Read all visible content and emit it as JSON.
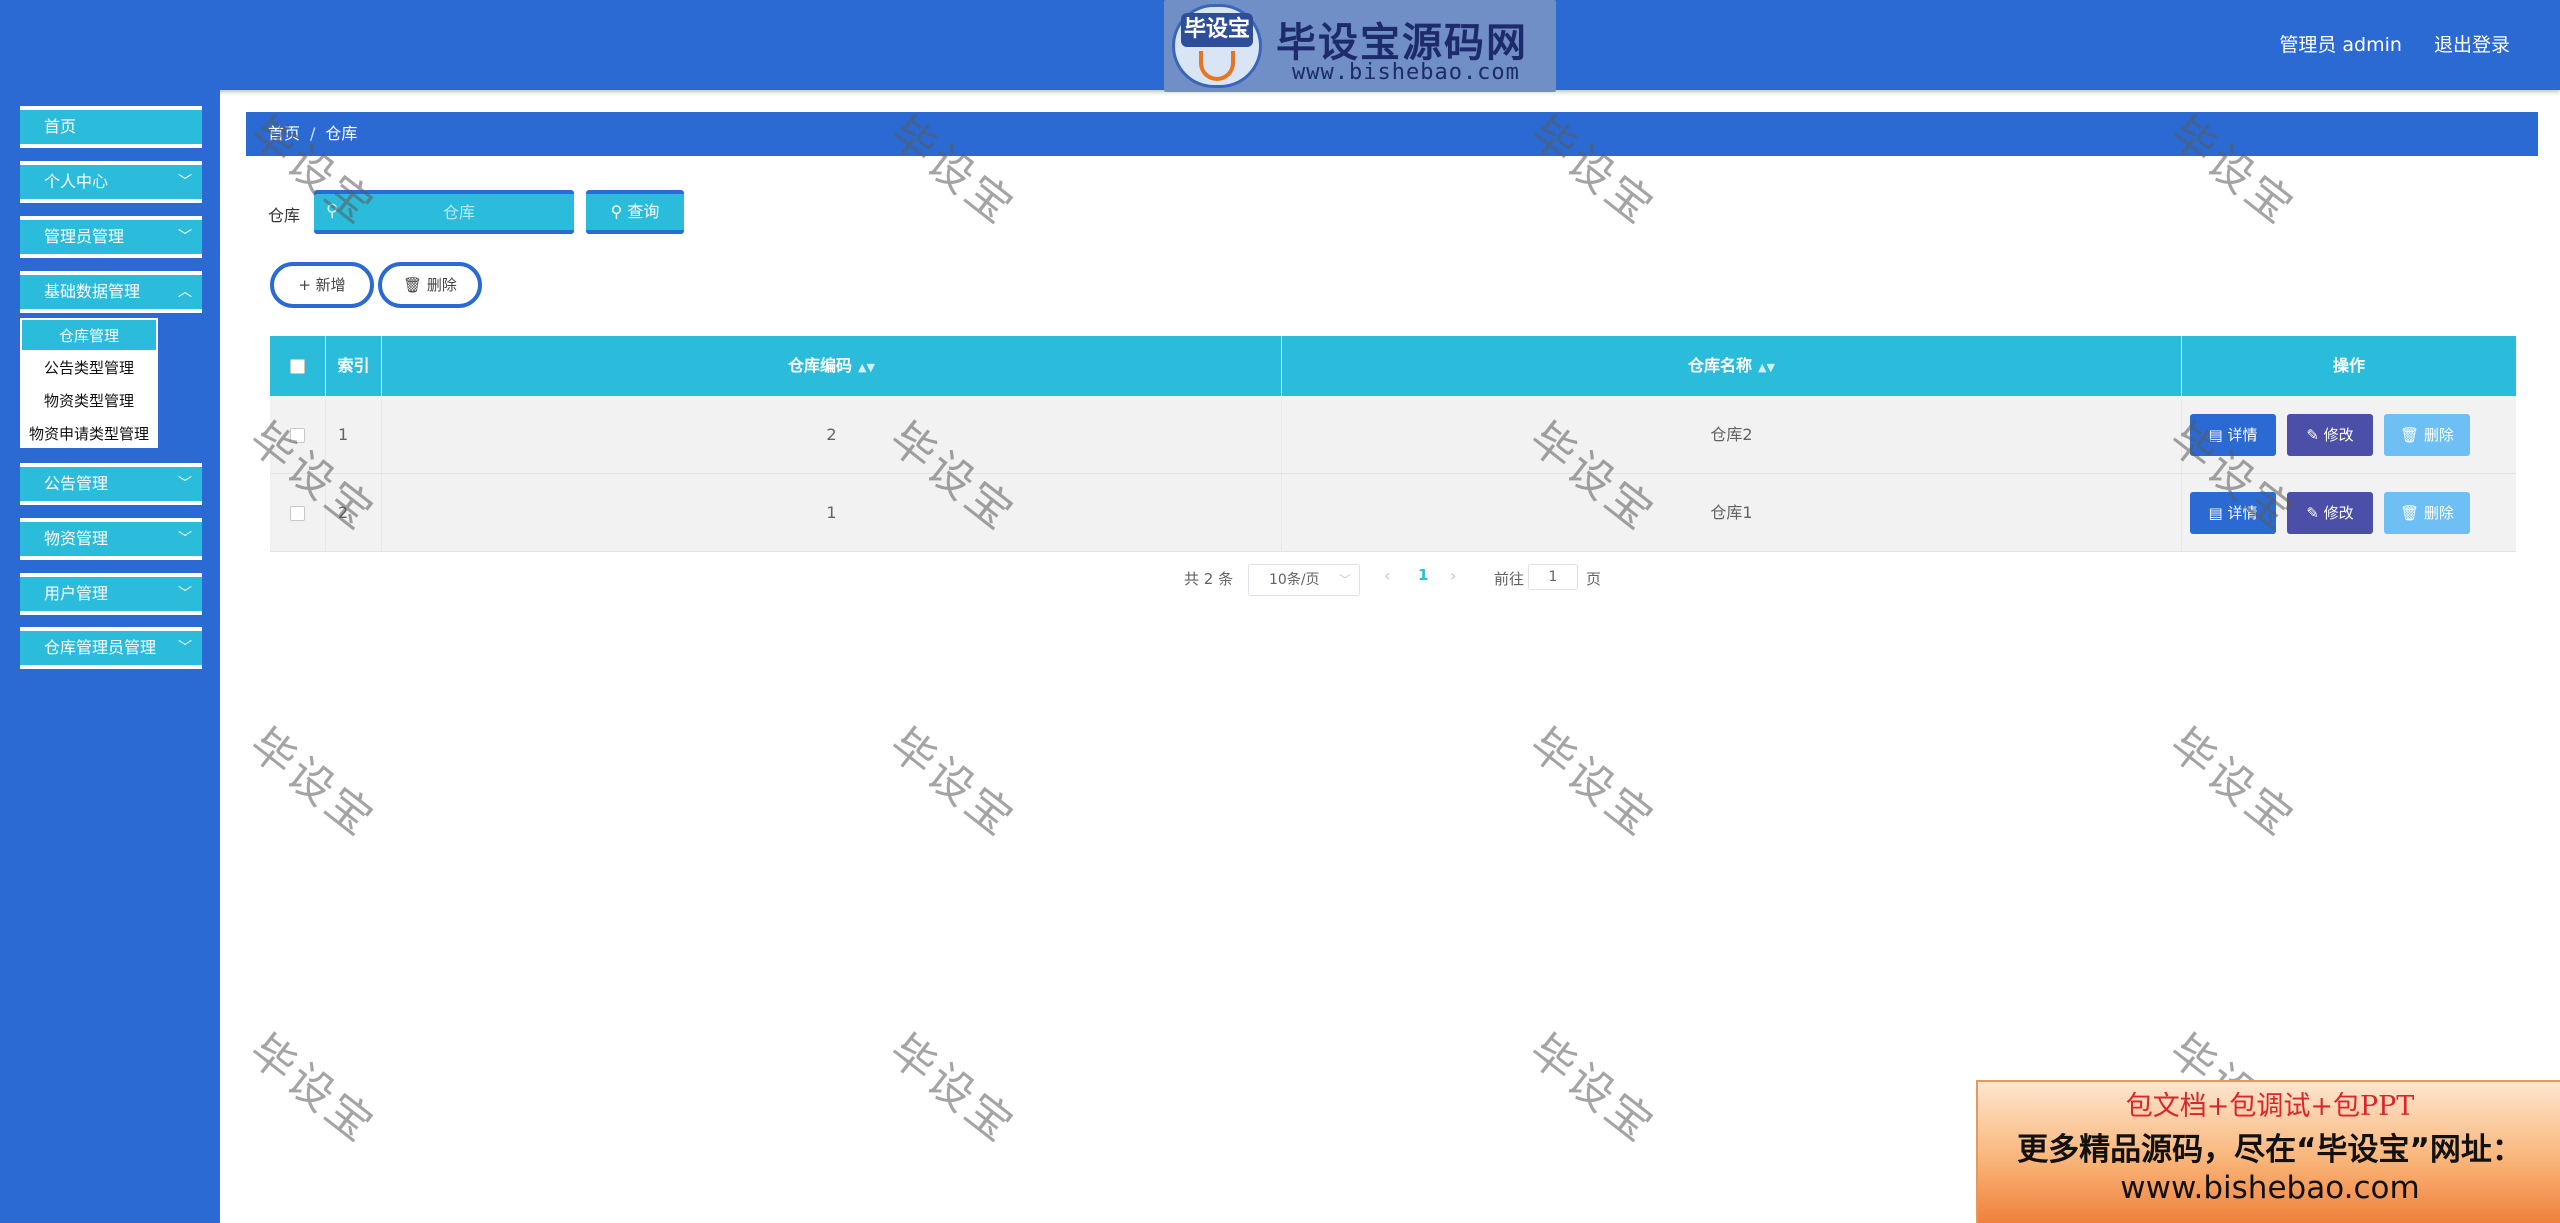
{
  "header": {
    "logo_text": "毕设宝",
    "logo_title": "毕设宝源码网",
    "logo_url": "www.bishebao.com",
    "user_label": "管理员 admin",
    "logout_label": "退出登录"
  },
  "sidebar": {
    "items": [
      {
        "label": "首页"
      },
      {
        "label": "个人中心"
      },
      {
        "label": "管理员管理"
      },
      {
        "label": "基础数据管理"
      },
      {
        "label": "公告管理"
      },
      {
        "label": "物资管理"
      },
      {
        "label": "用户管理"
      },
      {
        "label": "仓库管理员管理"
      }
    ],
    "submenu": [
      {
        "label": "仓库管理",
        "active": true
      },
      {
        "label": "公告类型管理"
      },
      {
        "label": "物资类型管理"
      },
      {
        "label": "物资申请类型管理"
      }
    ]
  },
  "breadcrumb": {
    "home": "首页",
    "separator": "/",
    "current": "仓库"
  },
  "search": {
    "label": "仓库",
    "placeholder": "仓库",
    "query_label": "查询"
  },
  "actions": {
    "add_label": "新增",
    "delete_label": "删除"
  },
  "table": {
    "columns": [
      "索引",
      "仓库编码",
      "仓库名称",
      "操作"
    ],
    "rows": [
      {
        "index": "1",
        "code": "2",
        "name": "仓库2"
      },
      {
        "index": "2",
        "code": "1",
        "name": "仓库1"
      }
    ],
    "row_actions": {
      "detail": "详情",
      "edit": "修改",
      "delete": "删除"
    }
  },
  "pagination": {
    "total": "共 2 条",
    "page_size": "10条/页",
    "current_page": "1",
    "goto_prefix": "前往",
    "goto_value": "1",
    "goto_suffix": "页"
  },
  "watermark": "毕设宝",
  "promo": {
    "line1": "包文档+包调试+包PPT",
    "line2": "更多精品源码，尽在“毕设宝”网址：",
    "line3": "www.bishebao.com"
  },
  "colors": {
    "primary": "#2a6ad2",
    "accent": "#2bbcdc",
    "edit": "#4b4fa8",
    "delete_light": "#6ec0f4"
  }
}
